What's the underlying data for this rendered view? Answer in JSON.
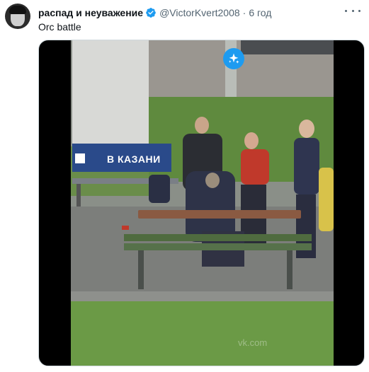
{
  "tweet": {
    "author_name": "распад и неуважение",
    "handle": "@VictorKvert2008",
    "separator": "·",
    "timestamp": "6 год",
    "text": "Orc battle"
  },
  "icons": {
    "verified": "verified-badge-icon",
    "more": "more-options-icon",
    "media_badge": "sparkle-icon"
  },
  "media": {
    "sign_text": "В КАЗАНИ",
    "watermark": "vk.com"
  },
  "colors": {
    "accent": "#1d9bf0",
    "text_primary": "#0f1419",
    "text_secondary": "#536471"
  }
}
